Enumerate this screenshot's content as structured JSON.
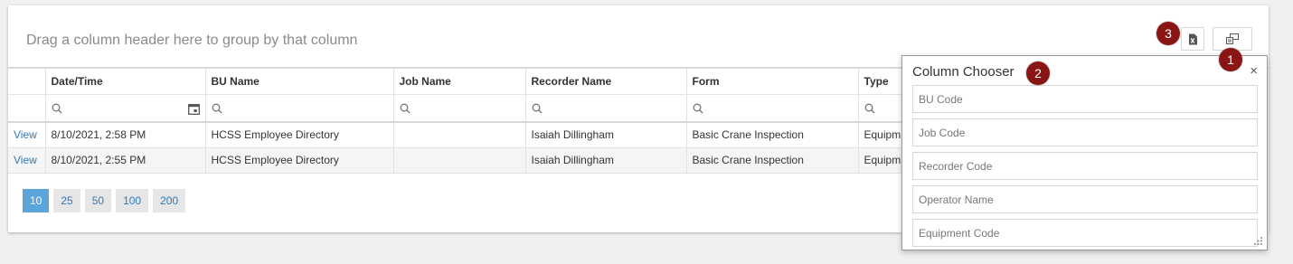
{
  "group_panel": {
    "text": "Drag a column header here to group by that column"
  },
  "toolbar": {
    "export_icon": "excel-export-icon",
    "chooser_icon": "column-chooser-icon"
  },
  "badges": [
    "1",
    "2",
    "3"
  ],
  "grid": {
    "columns": [
      "",
      "Date/Time",
      "BU Name",
      "Job Name",
      "Recorder Name",
      "Form",
      "Type"
    ],
    "rows": [
      {
        "action": "View",
        "datetime": "8/10/2021, 2:58 PM",
        "bu_name": "HCSS Employee Directory",
        "job_name": "",
        "recorder": "Isaiah Dillingham",
        "form": "Basic Crane Inspection",
        "type": "Equipm"
      },
      {
        "action": "View",
        "datetime": "8/10/2021, 2:55 PM",
        "bu_name": "HCSS Employee Directory",
        "job_name": "",
        "recorder": "Isaiah Dillingham",
        "form": "Basic Crane Inspection",
        "type": "Equipm"
      }
    ]
  },
  "pager": {
    "sizes": [
      "10",
      "25",
      "50",
      "100",
      "200"
    ],
    "selected": "10"
  },
  "column_chooser": {
    "title": "Column Chooser",
    "close": "×",
    "items": [
      "BU Code",
      "Job Code",
      "Recorder Code",
      "Operator Name",
      "Equipment Code"
    ]
  },
  "colors": {
    "accent": "#5aa6dc",
    "badge": "#8a1515",
    "link": "#337ab7"
  }
}
